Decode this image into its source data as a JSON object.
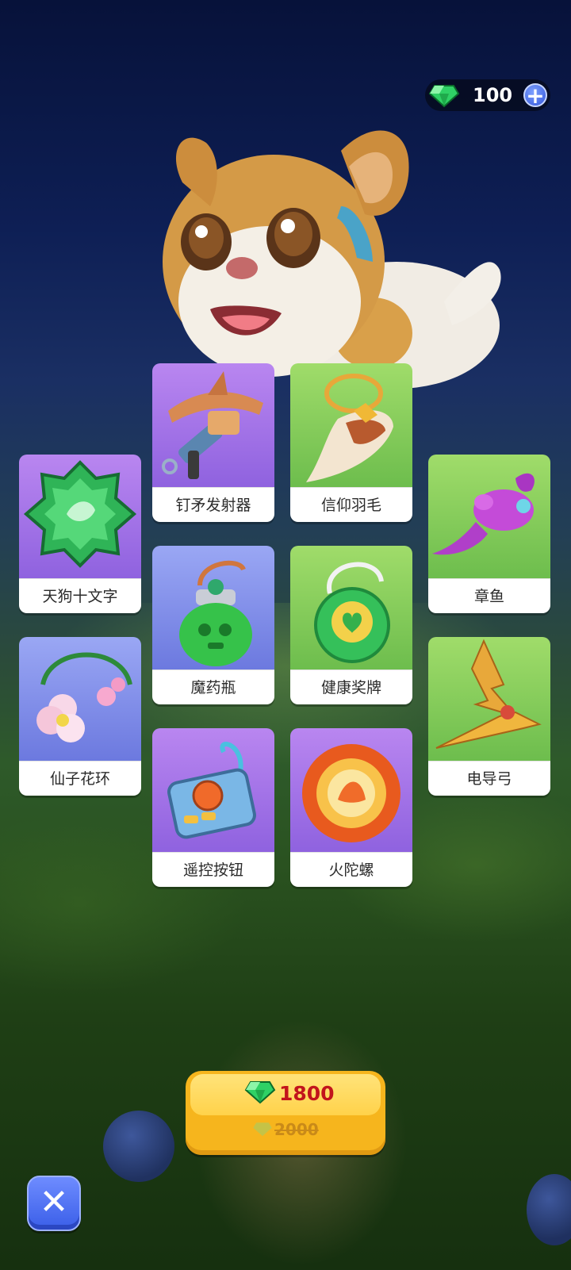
{
  "currency": {
    "amount": "100",
    "plus_label": "+"
  },
  "items": [
    {
      "name": "钉矛发射器",
      "bg": "purple"
    },
    {
      "name": "信仰羽毛",
      "bg": "green"
    },
    {
      "name": "天狗十文字",
      "bg": "purple"
    },
    {
      "name": "章鱼",
      "bg": "green"
    },
    {
      "name": "魔药瓶",
      "bg": "blue"
    },
    {
      "name": "健康奖牌",
      "bg": "green"
    },
    {
      "name": "仙子花环",
      "bg": "blue"
    },
    {
      "name": "电导弓",
      "bg": "green"
    },
    {
      "name": "遥控按钮",
      "bg": "purple"
    },
    {
      "name": "火陀螺",
      "bg": "purple"
    }
  ],
  "purchase": {
    "price": "1800",
    "original_price": "2000"
  },
  "close_label": "✕",
  "colors": {
    "price_red": "#c2141c",
    "button_gold": "#f6b51d",
    "close_blue": "#3a5ee8",
    "gem_green": "#27c25a"
  }
}
